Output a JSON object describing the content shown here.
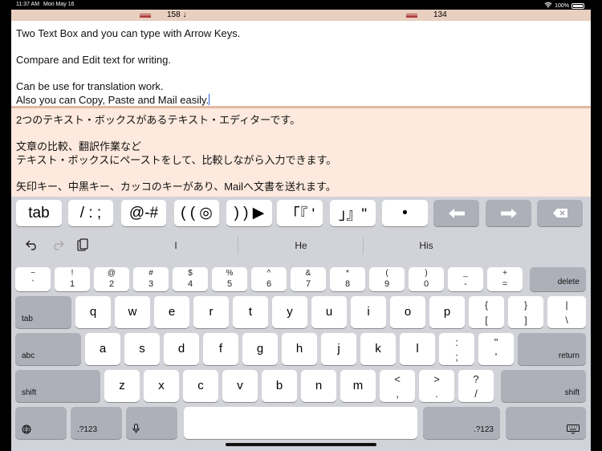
{
  "status_bar": {
    "time": "11:37 AM",
    "date": "Mon May 16",
    "battery": "100%"
  },
  "counter_bar": {
    "count_left": "158 ↓",
    "count_right": "134",
    "icon_name": "keyboard-icon"
  },
  "editor_top": {
    "lines": [
      "Two Text Box and you can type with Arrow Keys.",
      "",
      "Compare and Edit text for writing.",
      "",
      "Can be use for translation work.",
      "Also you can Copy, Paste and Mail easily."
    ]
  },
  "editor_bottom": {
    "lines": [
      "2つのテキスト・ボックスがあるテキスト・エディターです。",
      "",
      "文章の比較、翻訳作業など",
      "テキスト・ボックスにペーストをして、比較しながら入力できます。",
      "",
      "矢印キー、中黒キー、カッコのキーがあり、Mailへ文書を送れます。"
    ]
  },
  "accessory_keys": [
    {
      "label": "tab",
      "icon": null
    },
    {
      "label": "/ : ;",
      "icon": null
    },
    {
      "label": "@-#",
      "icon": null
    },
    {
      "label": "( ( ◎",
      "icon": null
    },
    {
      "label": ") ) ▶",
      "icon": null
    },
    {
      "label": "「『 '",
      "icon": null
    },
    {
      "label": "」』\"",
      "icon": null
    },
    {
      "label": "•",
      "icon": null
    },
    {
      "label": "",
      "icon": "arrow-left-icon"
    },
    {
      "label": "",
      "icon": "arrow-right-icon"
    },
    {
      "label": "",
      "icon": "delete-icon"
    }
  ],
  "suggestions": [
    "I",
    "He",
    "His"
  ],
  "keyboard": {
    "row1": [
      {
        "top": "~",
        "bot": "`"
      },
      {
        "top": "!",
        "bot": "1"
      },
      {
        "top": "@",
        "bot": "2"
      },
      {
        "top": "#",
        "bot": "3"
      },
      {
        "top": "$",
        "bot": "4"
      },
      {
        "top": "%",
        "bot": "5"
      },
      {
        "top": "^",
        "bot": "6"
      },
      {
        "top": "&",
        "bot": "7"
      },
      {
        "top": "*",
        "bot": "8"
      },
      {
        "top": "(",
        "bot": "9"
      },
      {
        "top": ")",
        "bot": "0"
      },
      {
        "top": "_",
        "bot": "-"
      },
      {
        "top": "+",
        "bot": "="
      }
    ],
    "delete": "delete",
    "tab": "tab",
    "row2": [
      "q",
      "w",
      "e",
      "r",
      "t",
      "y",
      "u",
      "i",
      "o",
      "p"
    ],
    "row2_sym": [
      {
        "top": "{",
        "bot": "["
      },
      {
        "top": "}",
        "bot": "]"
      },
      {
        "top": "|",
        "bot": "\\"
      }
    ],
    "abc": "abc",
    "row3": [
      "a",
      "s",
      "d",
      "f",
      "g",
      "h",
      "j",
      "k",
      "l"
    ],
    "row3_sym": [
      {
        "top": ":",
        "bot": ";"
      },
      {
        "top": "\"",
        "bot": "'"
      }
    ],
    "return": "return",
    "shift": "shift",
    "row4": [
      "z",
      "x",
      "c",
      "v",
      "b",
      "n",
      "m"
    ],
    "row4_sym": [
      {
        "top": "<",
        "bot": ","
      },
      {
        "top": ">",
        "bot": "."
      },
      {
        "top": "?",
        "bot": "/"
      }
    ],
    "numbers": ".?123"
  }
}
